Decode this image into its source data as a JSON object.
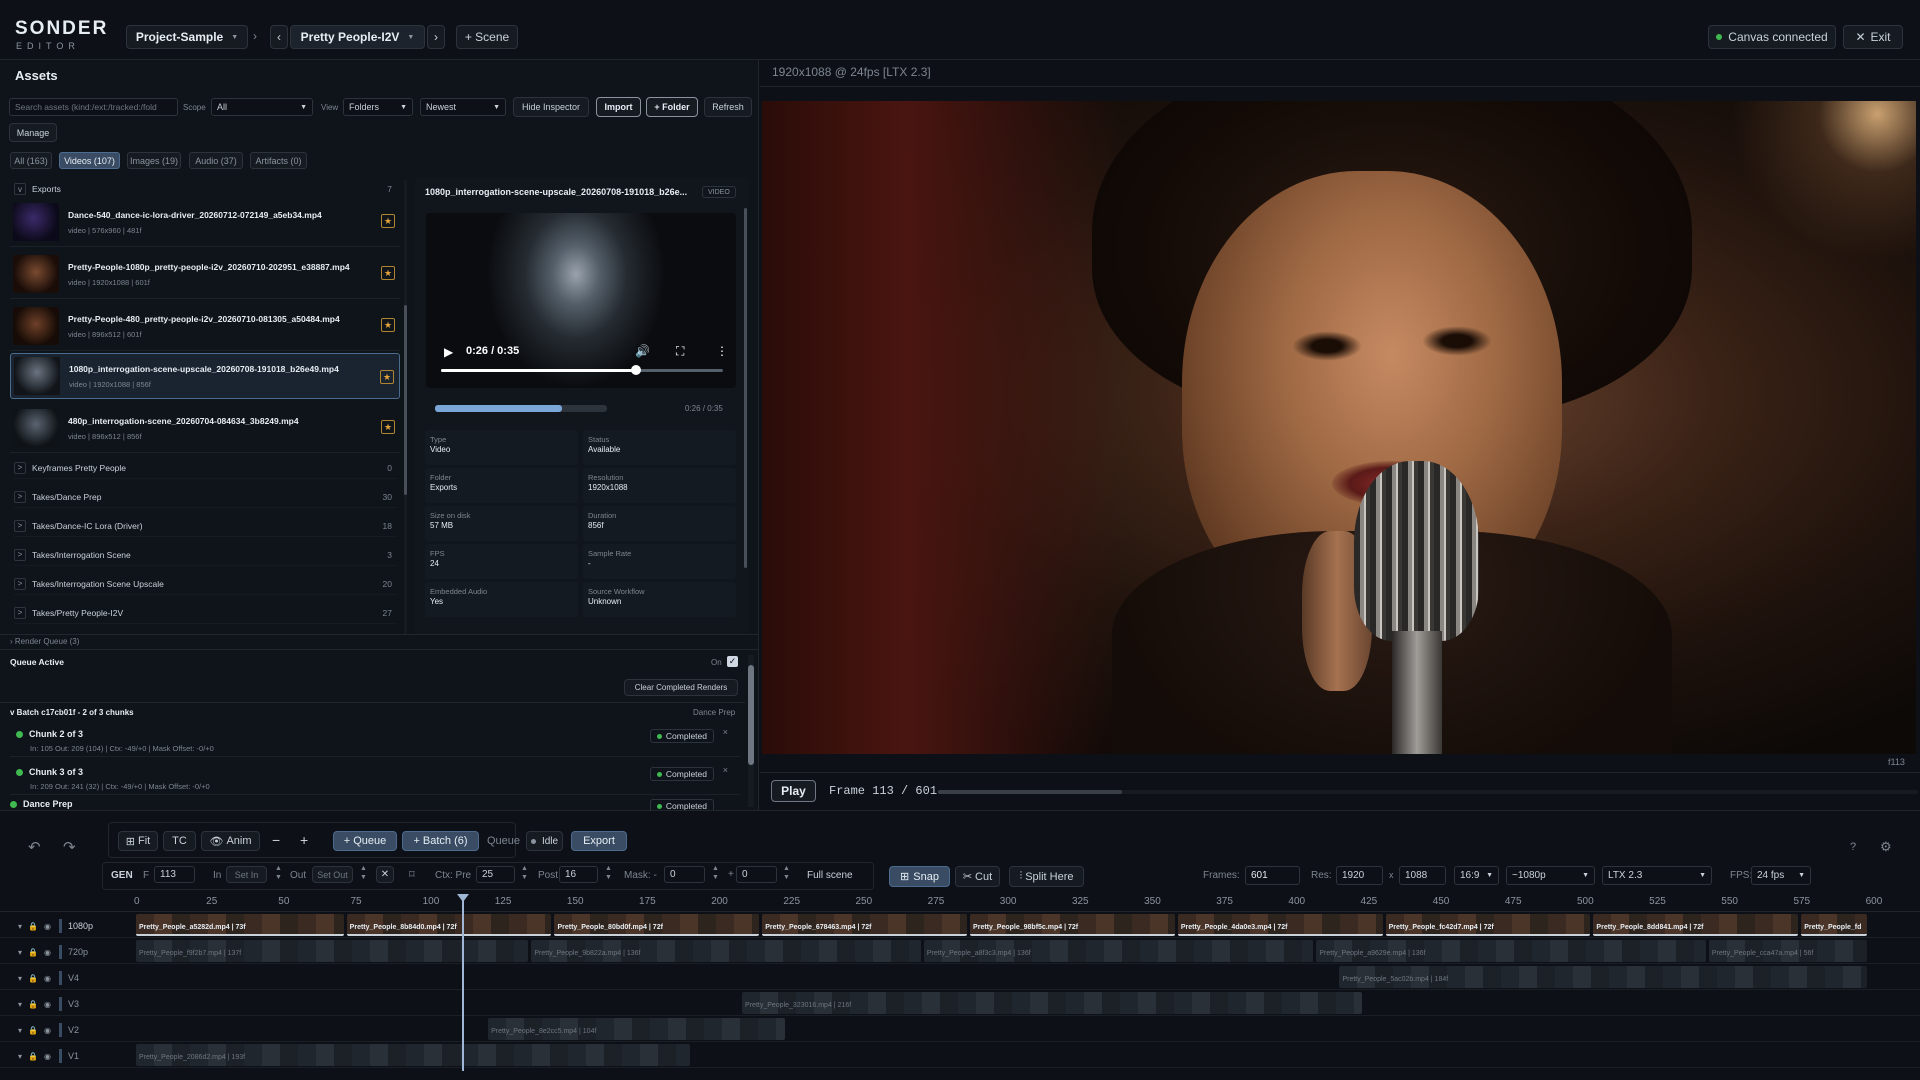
{
  "header": {
    "logo": "SONDER",
    "logo_sub": "EDITOR",
    "project": "Project-Sample",
    "sequence": "Pretty People-I2V",
    "add_scene": "+ Scene",
    "canvas_status": "Canvas connected",
    "exit": "Exit"
  },
  "assets": {
    "title": "Assets",
    "search_placeholder": "Search assets (kind:/ext:/tracked:/fold",
    "scope_label": "Scope",
    "scope_value": "All",
    "view_label": "View",
    "view_value": "Folders",
    "sort_value": "Newest",
    "hide_inspector": "Hide Inspector",
    "import": "Import",
    "add_folder": "+ Folder",
    "refresh": "Refresh",
    "manage": "Manage",
    "tabs": [
      "All (163)",
      "Videos (107)",
      "Images (19)",
      "Audio (37)",
      "Artifacts (0)"
    ],
    "exports_folder": {
      "name": "Exports",
      "count": "7"
    },
    "files": [
      {
        "name": "Dance-540_dance-ic-lora-driver_20260712-072149_a5eb34.mp4",
        "meta": "video | 576x960 | 481f"
      },
      {
        "name": "Pretty-People-1080p_pretty-people-i2v_20260710-202951_e38887.mp4",
        "meta": "video | 1920x1088 | 601f"
      },
      {
        "name": "Pretty-People-480_pretty-people-i2v_20260710-081305_a50484.mp4",
        "meta": "video | 896x512 | 601f"
      },
      {
        "name": "1080p_interrogation-scene-upscale_20260708-191018_b26e49.mp4",
        "meta": "video | 1920x1088 | 856f"
      },
      {
        "name": "480p_interrogation-scene_20260704-084634_3b8249.mp4",
        "meta": "video | 896x512 | 856f"
      }
    ],
    "folders": [
      {
        "name": "Keyframes Pretty People",
        "count": "0"
      },
      {
        "name": "Takes/Dance Prep",
        "count": "30"
      },
      {
        "name": "Takes/Dance-IC Lora (Driver)",
        "count": "18"
      },
      {
        "name": "Takes/Interrogation Scene",
        "count": "3"
      },
      {
        "name": "Takes/Interrogation Scene Upscale",
        "count": "20"
      },
      {
        "name": "Takes/Pretty People-I2V",
        "count": "27"
      }
    ],
    "inspector": {
      "title": "1080p_interrogation-scene-upscale_20260708-191018_b26e...",
      "kind_badge": "VIDEO",
      "player_time": "0:26 / 0:35",
      "player_progress": 0.69,
      "scrub_progress": 0.74,
      "scrub_time": "0:26 / 0:35",
      "props": [
        {
          "k": "Type",
          "v": "Video"
        },
        {
          "k": "Status",
          "v": "Available"
        },
        {
          "k": "Folder",
          "v": "Exports"
        },
        {
          "k": "Resolution",
          "v": "1920x1088"
        },
        {
          "k": "Size on disk",
          "v": "57 MB"
        },
        {
          "k": "Duration",
          "v": "856f"
        },
        {
          "k": "FPS",
          "v": "24"
        },
        {
          "k": "Sample Rate",
          "v": "-"
        },
        {
          "k": "Embedded Audio",
          "v": "Yes"
        },
        {
          "k": "Source Workflow",
          "v": "Unknown"
        }
      ]
    }
  },
  "render_queue": {
    "header": "Render Queue (3)",
    "active": "Queue Active",
    "on_label": "On",
    "clear": "Clear Completed Renders",
    "batch": "Batch c17cb01f - 2 of 3 chunks",
    "batch_tag": "Dance Prep",
    "chunks": [
      {
        "name": "Chunk 2 of 3",
        "detail": "In: 105 Out: 209 (104) | Ctx: -49/+0 | Mask Offset: -0/+0",
        "status": "Completed"
      },
      {
        "name": "Chunk 3 of 3",
        "detail": "In: 209 Out: 241 (32) | Ctx: -49/+0 | Mask Offset: -0/+0",
        "status": "Completed"
      },
      {
        "name": "Dance Prep",
        "detail": "",
        "status": "Completed"
      }
    ]
  },
  "viewer": {
    "info": "1920x1088 @ 24fps [LTX 2.3]",
    "frame_tag": "f113",
    "play": "Play",
    "frame_text": "Frame 113 / 601",
    "playhead_fraction": 0.188
  },
  "toolbar": {
    "fit": "Fit",
    "tc": "TC",
    "anim": "Anim",
    "minus": "−",
    "plus": "+",
    "queue": "+ Queue",
    "batch": "+ Batch (6)",
    "queue_label": "Queue",
    "idle": "Idle",
    "export": "Export",
    "gen": "GEN",
    "f_label": "F",
    "frame_value": "113",
    "in_label": "In",
    "set_in": "Set In",
    "out_label": "Out",
    "set_out": "Set Out",
    "ctx_label": "Ctx: Pre",
    "pre_value": "25",
    "post_label": "Post",
    "post_value": "16",
    "mask_label": "Mask: -",
    "mask_a": "0",
    "mask_plus": "+",
    "mask_b": "0",
    "full_scene": "Full scene",
    "snap": "Snap",
    "cut": "Cut",
    "split": "Split Here",
    "frames_label": "Frames:",
    "frames_value": "601",
    "res_label": "Res:",
    "res_w": "1920",
    "res_x": "x",
    "res_h": "1088",
    "aspect": "16:9",
    "quality": "~1080p",
    "model": "LTX 2.3",
    "fps_label": "FPS:",
    "fps_value": "24 fps",
    "help": "?"
  },
  "timeline": {
    "ruler": [
      "0",
      "25",
      "50",
      "75",
      "100",
      "125",
      "150",
      "175",
      "200",
      "225",
      "250",
      "275",
      "300",
      "325",
      "350",
      "375",
      "400",
      "425",
      "450",
      "475",
      "500",
      "525",
      "550",
      "575",
      "600"
    ],
    "total_frames": 601,
    "playhead_frame": 113,
    "tracks": [
      {
        "name": "1080p",
        "clips": [
          {
            "label": "Pretty_People_a5282d.mp4 | 73f",
            "start": 0,
            "len": 73
          },
          {
            "label": "Pretty_People_8b84d0.mp4 | 72f",
            "start": 73,
            "len": 72
          },
          {
            "label": "Pretty_People_80bd0f.mp4 | 72f",
            "start": 145,
            "len": 72
          },
          {
            "label": "Pretty_People_678463.mp4 | 72f",
            "start": 217,
            "len": 72
          },
          {
            "label": "Pretty_People_98bf5c.mp4 | 72f",
            "start": 289,
            "len": 72
          },
          {
            "label": "Pretty_People_4da0e3.mp4 | 72f",
            "start": 361,
            "len": 72
          },
          {
            "label": "Pretty_People_fc42d7.mp4 | 72f",
            "start": 433,
            "len": 72
          },
          {
            "label": "Pretty_People_8dd841.mp4 | 72f",
            "start": 505,
            "len": 72
          },
          {
            "label": "Pretty_People_fd",
            "start": 577,
            "len": 24
          }
        ]
      },
      {
        "name": "720p",
        "clips": [
          {
            "label": "Pretty_People_f9f2b7.mp4 | 137f",
            "start": 0,
            "len": 137
          },
          {
            "label": "Pretty_People_9b822a.mp4 | 136f",
            "start": 137,
            "len": 136
          },
          {
            "label": "Pretty_People_a8f3c3.mp4 | 136f",
            "start": 273,
            "len": 136
          },
          {
            "label": "Pretty_People_a9629e.mp4 | 136f",
            "start": 409,
            "len": 136
          },
          {
            "label": "Pretty_People_cca47a.mp4 | 56f",
            "start": 545,
            "len": 56
          }
        ]
      },
      {
        "name": "V4",
        "clips": [
          {
            "label": "Pretty_People_5ac02b.mp4 | 184f",
            "start": 417,
            "len": 184
          }
        ]
      },
      {
        "name": "V3",
        "clips": [
          {
            "label": "Pretty_People_323016.mp4 | 216f",
            "start": 210,
            "len": 216
          }
        ]
      },
      {
        "name": "V2",
        "clips": [
          {
            "label": "Pretty_People_8e2cc5.mp4 | 104f",
            "start": 122,
            "len": 104
          }
        ]
      },
      {
        "name": "V1",
        "clips": [
          {
            "label": "Pretty_People_2086d2.mp4 | 193f",
            "start": 0,
            "len": 193
          }
        ]
      }
    ]
  },
  "colors": {
    "accent": "#4b6b8f",
    "success": "#3fb950",
    "playhead": "#9fb7d4"
  }
}
